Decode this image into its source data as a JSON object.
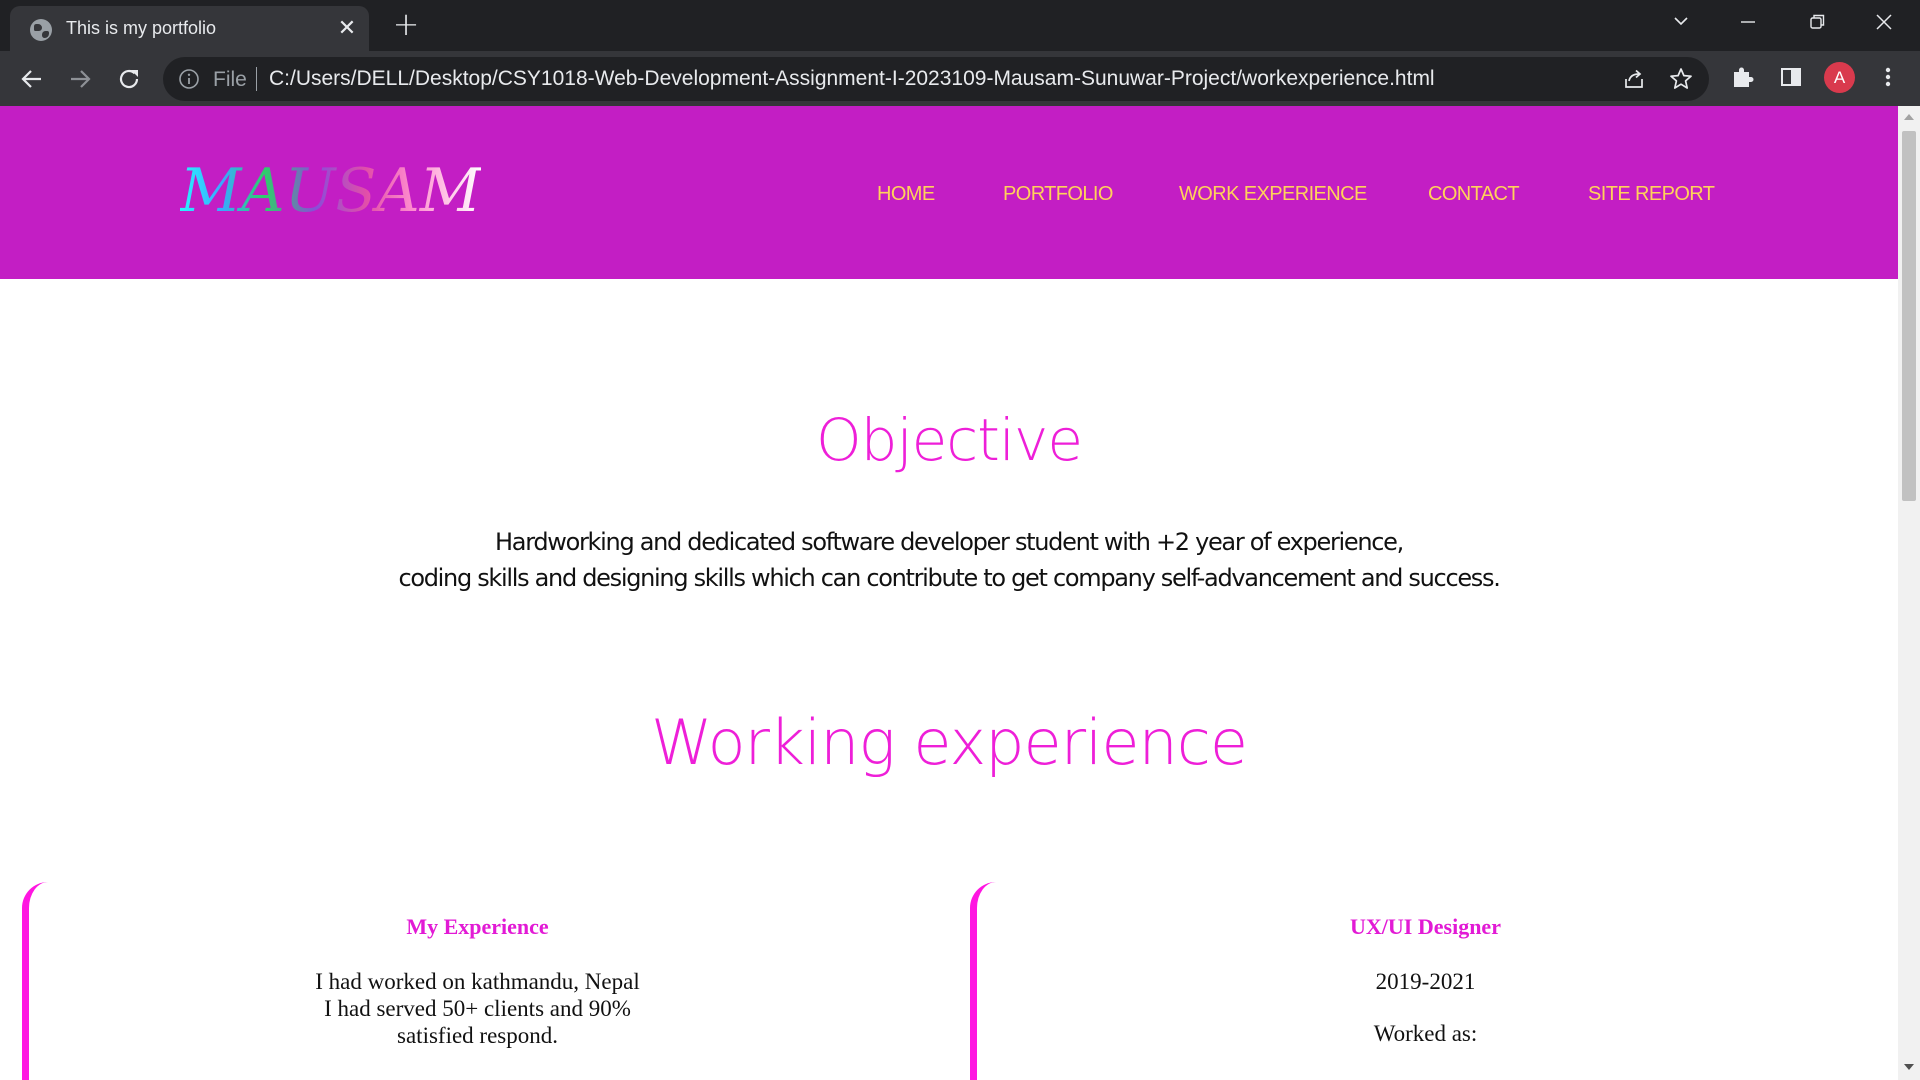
{
  "browser": {
    "tab_title": "This is my portfolio",
    "omnibox": {
      "scheme_label": "File",
      "url": "C:/Users/DELL/Desktop/CSY1018-Web-Development-Assignment-I-2023109-Mausam-Sunuwar-Project/workexperience.html"
    },
    "profile_initial": "A",
    "icons": [
      "globe-icon",
      "close-icon",
      "plus-icon",
      "chevron-down-icon",
      "minimize-icon",
      "restore-icon",
      "close-icon",
      "back-arrow-icon",
      "forward-arrow-icon",
      "reload-icon",
      "info-icon",
      "share-icon",
      "star-icon",
      "puzzle-icon",
      "side-panel-icon",
      "kebab-menu-icon"
    ]
  },
  "site": {
    "logo": "MAUSAM",
    "nav": {
      "home": "HOME",
      "portfolio": "PORTFOLIO",
      "work_experience": "WORK EXPERIENCE",
      "contact": "CONTACT",
      "site_report": "SITE REPORT"
    },
    "objective": {
      "title": "Objective",
      "line1": "Hardworking and dedicated software developer student with +2 year of experience,",
      "line2": "coding skills and designing skills which can contribute to get company self-advancement and success."
    },
    "working": {
      "title": "Working experience",
      "cards": [
        {
          "heading": "My Experience",
          "lines": [
            "I had worked on kathmandu, Nepal",
            "I had served 50+ clients and 90%",
            "satisfied respond."
          ]
        },
        {
          "heading": "UX/UI Designer",
          "years": "2019-2021",
          "role_label": "Worked as:"
        }
      ]
    }
  },
  "colors": {
    "header_bg": "#c31ec4",
    "nav_link": "#ffd25a",
    "accent_pink": "#ee1fd8",
    "card_border": "#ff16e1",
    "chrome_dark": "#202124",
    "chrome_mid": "#35363a"
  }
}
